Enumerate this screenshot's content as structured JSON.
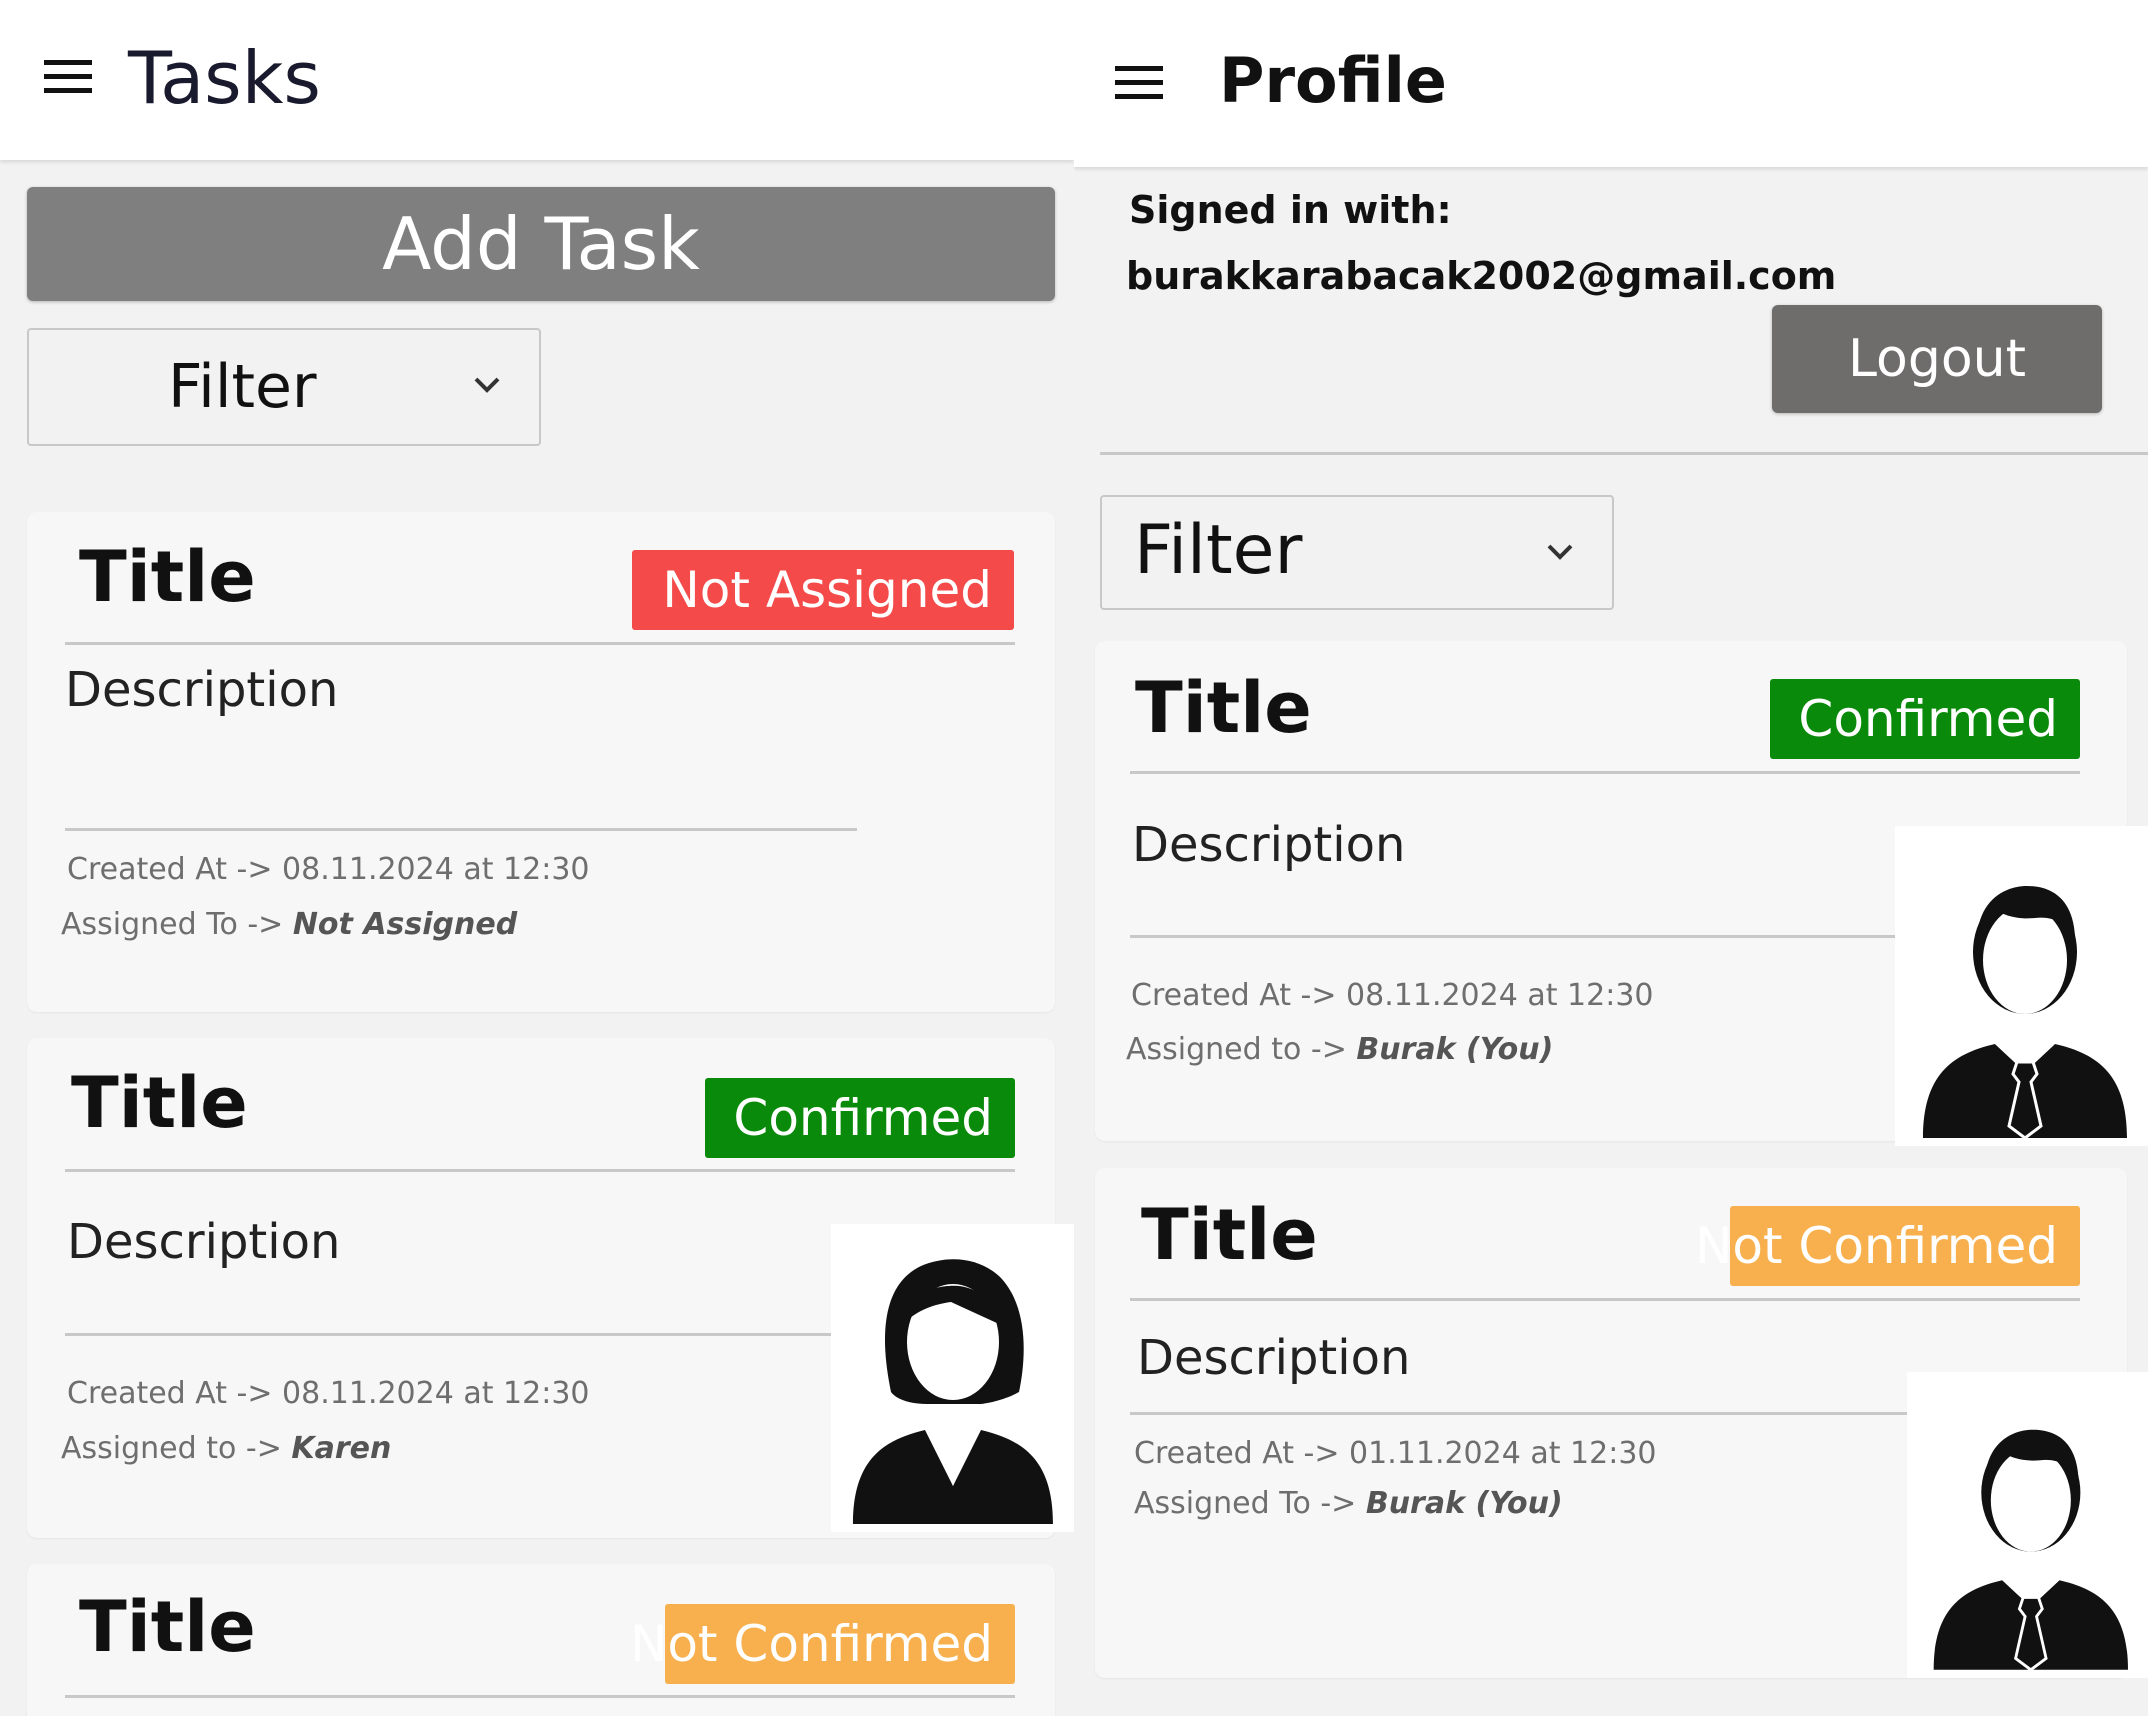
{
  "tasks_screen": {
    "title": "Tasks",
    "add_task_label": "Add Task",
    "filter_label": "Filter",
    "cards": [
      {
        "title": "Title",
        "status": "Not Assigned",
        "status_color": "#f44a4a",
        "description": "Description",
        "created_at": "Created At -> 08.11.2024 at 12:30",
        "assigned_prefix": "Assigned To -> ",
        "assigned_name": "Not Assigned"
      },
      {
        "title": "Title",
        "status": "Confirmed",
        "status_color": "#0a8a0a",
        "description": "Description",
        "created_at": "Created At -> 08.11.2024 at 12:30",
        "assigned_prefix": "Assigned to -> ",
        "assigned_name": "Karen",
        "avatar_icon": "female-avatar-icon"
      },
      {
        "title": "Title",
        "status": "Not Confirmed",
        "status_color": "#f8b04e"
      }
    ]
  },
  "profile_screen": {
    "title": "Profile",
    "signed_in_label": "Signed in with:",
    "email": "burakkarabacak2002@gmail.com",
    "logout_label": "Logout",
    "filter_label": "Filter",
    "cards": [
      {
        "title": "Title",
        "status": "Confirmed",
        "status_color": "#0a8a0a",
        "description": "Description",
        "created_at": "Created At -> 08.11.2024 at 12:30",
        "assigned_prefix": "Assigned to -> ",
        "assigned_name": "Burak (You)",
        "avatar_icon": "male-avatar-icon"
      },
      {
        "title": "Title",
        "status": "Not Confirmed",
        "status_color": "#f8b04e",
        "description": "Description",
        "created_at": "Created At -> 01.11.2024 at 12:30",
        "assigned_prefix": "Assigned To -> ",
        "assigned_name": "Burak (You)",
        "avatar_icon": "male-avatar-icon"
      }
    ]
  },
  "colors": {
    "add_task_button": "#7f7f7f",
    "logout_button": "#6f6c6c",
    "divider": "#c8c8c8"
  }
}
